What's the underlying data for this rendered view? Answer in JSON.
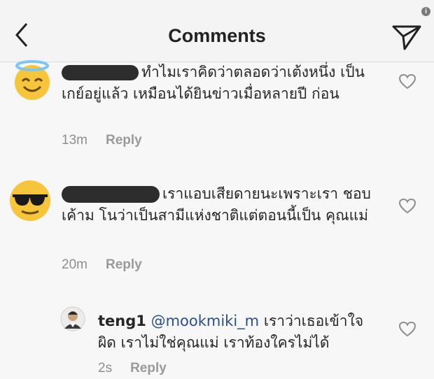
{
  "header": {
    "title": "Comments",
    "back_icon": "chevron-left-icon",
    "send_icon": "paper-plane-icon",
    "info_icon": "info-icon",
    "info_label": "i"
  },
  "comments": [
    {
      "avatar": "halo-smiley-emoji",
      "text": "ทำไมเราคิดว่าตลอดว่าเต้งหนึ่ง เป็นเกย์อยู่แล้ว เหมือนได้ยินข่าวเมื่อหลายปี ก่อน",
      "time": "13m",
      "reply_label": "Reply"
    },
    {
      "avatar": "sunglasses-emoji",
      "text": "เราแอบเสียดายนะเพราะเรา ชอบเค้าม โนว่าเป็นสามีแห่งชาติแต่ตอนนี้เป็น คุณแม่",
      "time": "20m",
      "reply_label": "Reply"
    },
    {
      "avatar": "profile-photo",
      "username": "teng1",
      "mention": "@mookmiki_m",
      "text": "เราว่าเธอเข้าใจ ผิด เราไม่ใช่คุณแม่ เราท้องใครไม่ได้",
      "time": "2s",
      "reply_label": "Reply"
    }
  ],
  "colors": {
    "mention": "#2b4f88",
    "meta": "#8e8e8e",
    "emoji_yellow": "#f7c53b"
  }
}
